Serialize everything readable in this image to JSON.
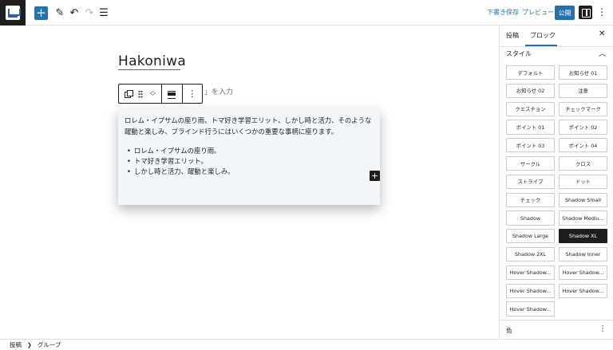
{
  "toolbar": {
    "save_draft": "下書き保存",
    "preview": "プレビュー",
    "publish": "公開"
  },
  "canvas": {
    "title": "Hakoniwa",
    "placeholder_hint": "」を入力",
    "paragraph": "ロレム・イプサムの座り雨、トマ好き学習エリット、しかし時と活力、そのような躍動と楽しみ、ブラインド行うにはいくつかの重要な事柄に座ります。",
    "list": [
      "ロレム・イプサムの座り雨。",
      "トマ好き学習エリット。",
      "しかし時と活力、躍動と楽しみ。"
    ]
  },
  "sidebar": {
    "tabs": [
      "投稿",
      "ブロック"
    ],
    "active_tab": "ブロック",
    "styles_title": "スタイル",
    "styles": [
      "デフォルト",
      "お知らせ 01",
      "お知らせ 02",
      "注意",
      "クエスチョン",
      "チェックマーク",
      "ポイント 01",
      "ポイント 02",
      "ポイント 03",
      "ポイント 04",
      "サークル",
      "クロス",
      "ストライプ",
      "ドット",
      "チェック",
      "Shadow Small",
      "Shadow",
      "Shadow Mediu...",
      "Shadow Large",
      "Shadow XL",
      "Shadow 2XL",
      "Shadow Inner",
      "Hover Shadow...",
      "Hover Shadow...",
      "Hover Shadow...",
      "Hover Shadow...",
      "Hover Shadow..."
    ],
    "active_style": "Shadow XL",
    "color_section": "色"
  },
  "breadcrumb": [
    "投稿",
    "グループ"
  ],
  "colors": {
    "accent": "#2271b1",
    "dark": "#1e1e1e",
    "group_bg": "#f3f6f9"
  }
}
